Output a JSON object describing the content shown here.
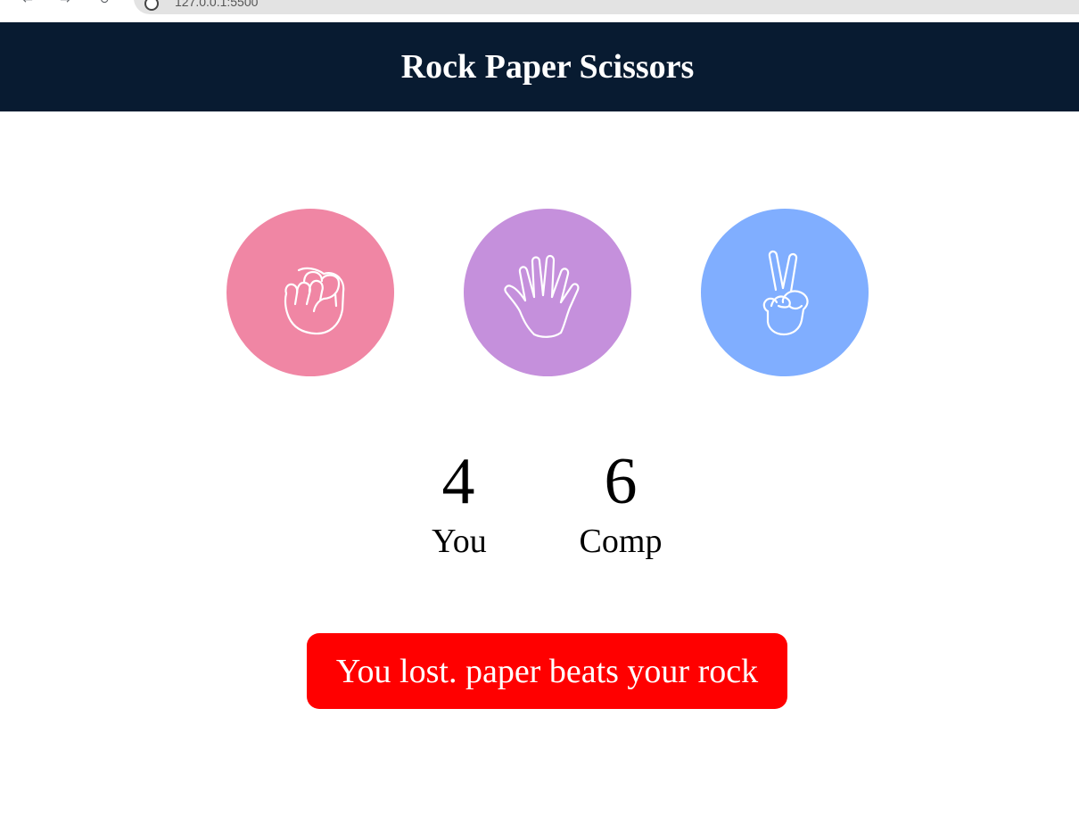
{
  "browser": {
    "address": "127.0.0.1:5500"
  },
  "header": {
    "title": "Rock Paper Scissors"
  },
  "choices": [
    {
      "name": "rock",
      "icon": "fist-icon",
      "color": "#f086a4"
    },
    {
      "name": "paper",
      "icon": "open-hand-icon",
      "color": "#c590dc"
    },
    {
      "name": "scissors",
      "icon": "peace-sign-icon",
      "color": "#80aeff"
    }
  ],
  "score": {
    "user_score": "4",
    "user_label": "You",
    "comp_score": "6",
    "comp_label": "Comp"
  },
  "message": {
    "text": "You lost. paper beats your rock",
    "color": "#ff0000"
  }
}
